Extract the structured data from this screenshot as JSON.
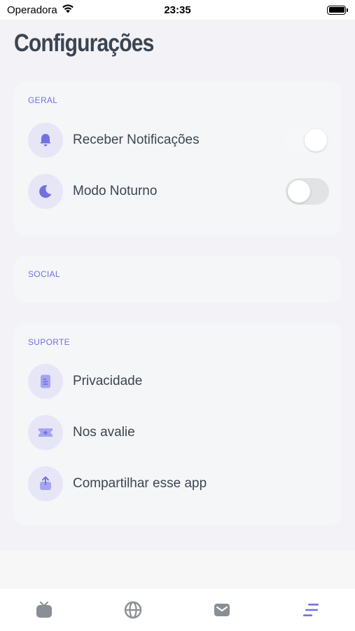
{
  "status_bar": {
    "carrier": "Operadora",
    "time": "23:35"
  },
  "page": {
    "title": "Configurações"
  },
  "sections": {
    "general": {
      "header": "GERAL",
      "notifications_label": "Receber Notificações",
      "notifications_enabled": true,
      "dark_mode_label": "Modo Noturno",
      "dark_mode_enabled": false
    },
    "social": {
      "header": "SOCIAL"
    },
    "support": {
      "header": "SUPORTE",
      "privacy_label": "Privacidade",
      "rate_label": "Nos avalie",
      "share_label": "Compartilhar esse app"
    }
  },
  "tab_bar": {
    "tabs": [
      {
        "icon": "tv-icon",
        "active": false
      },
      {
        "icon": "globe-icon",
        "active": false
      },
      {
        "icon": "mail-icon",
        "active": false
      },
      {
        "icon": "menu-icon",
        "active": true
      }
    ]
  },
  "colors": {
    "accent": "#7270e3",
    "icon_bg": "#e6e6f7",
    "title": "#3a4552",
    "card_bg": "#f4f6f8",
    "page_bg": "#f2f2f7",
    "inactive_tab": "#8a8f95"
  }
}
